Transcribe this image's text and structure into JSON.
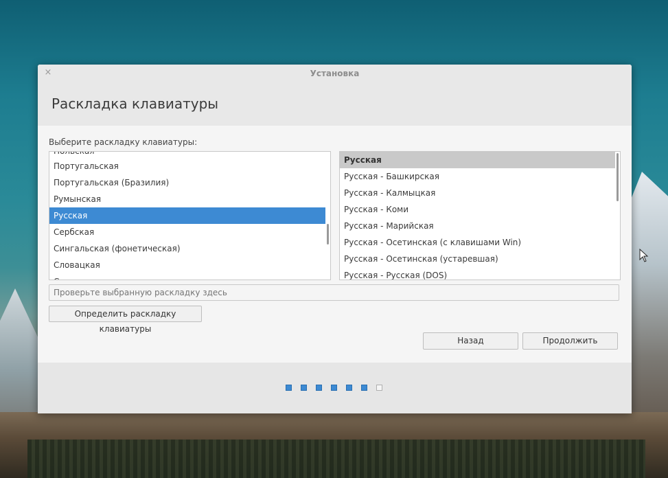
{
  "window": {
    "title": "Установка",
    "close_glyph": "×"
  },
  "header": {
    "title": "Раскладка клавиатуры"
  },
  "main": {
    "prompt": "Выберите раскладку клавиатуры:",
    "languages": [
      "Польская",
      "Португальская",
      "Португальская (Бразилия)",
      "Румынская",
      "Русская",
      "Сербская",
      "Сингальская (фонетическая)",
      "Словацкая",
      "Словенская"
    ],
    "selected_language": "Русская",
    "variants": [
      "Русская",
      "Русская - Башкирская",
      "Русская - Калмыцкая",
      "Русская - Коми",
      "Русская - Марийская",
      "Русская - Осетинская (с клавишами Win)",
      "Русская - Осетинская (устаревшая)",
      "Русская - Русская (DOS)"
    ],
    "selected_variant": "Русская",
    "test_placeholder": "Проверьте выбранную раскладку здесь",
    "detect_button": "Определить раскладку клавиатуры",
    "back_button": "Назад",
    "continue_button": "Продолжить"
  },
  "footer": {
    "steps_total": 7,
    "steps_completed": 6
  },
  "colors": {
    "accent": "#3d8ad3",
    "selected_gray": "#c9c9c9"
  }
}
